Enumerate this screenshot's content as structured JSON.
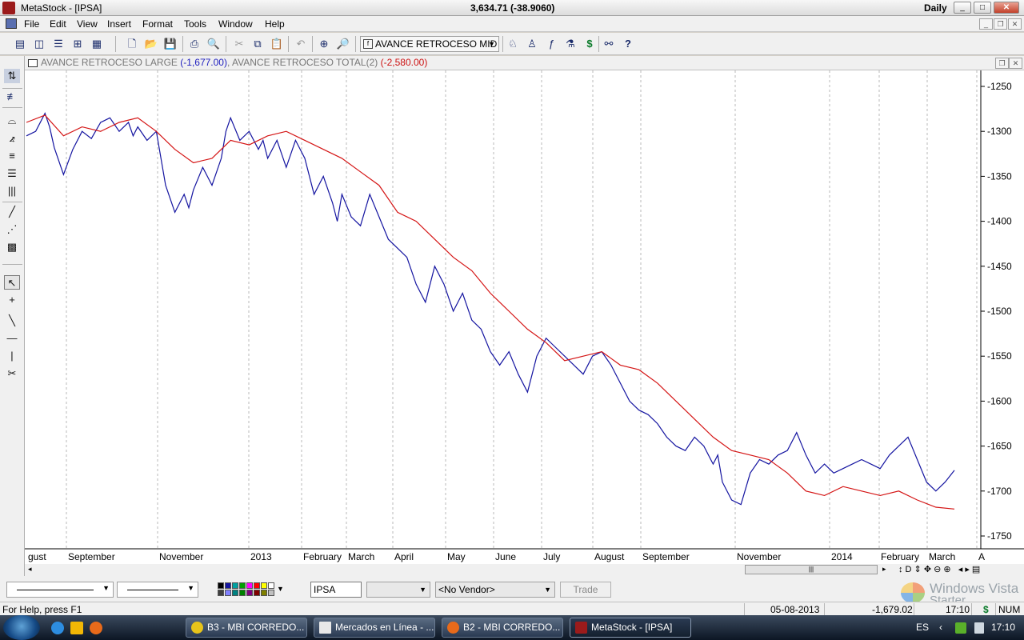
{
  "window": {
    "title": "MetaStock - [IPSA]",
    "quote": "3,634.71 (-38.9060)",
    "period": "Daily",
    "controls": [
      "_",
      "□",
      "✕"
    ]
  },
  "menu": [
    "File",
    "Edit",
    "View",
    "Insert",
    "Format",
    "Tools",
    "Window",
    "Help"
  ],
  "toolbar": {
    "indicator_selected": "AVANCE RETROCESO MID",
    "icons": [
      "tile-vertical-icon",
      "tile-columns-icon",
      "tile-rows-icon",
      "grid-icon",
      "new-icon",
      "open-icon",
      "save-icon",
      "print-icon",
      "print-preview-icon",
      "cut-icon",
      "copy-icon",
      "paste-icon",
      "undo-icon",
      "crosshair-icon",
      "zoom-icon",
      "expert-icon",
      "explorer-icon",
      "formula-icon",
      "system-tester-icon",
      "dollar-icon",
      "binoculars-icon",
      "help-icon"
    ]
  },
  "chart_window": {
    "series_label_1": "AVANCE RETROCESO LARGE",
    "series_value_1": "(-1,677.00)",
    "separator": ", ",
    "series_label_2": "AVANCE RETROCESO TOTAL(2)",
    "series_value_2": "(-2,580.00)"
  },
  "chart_data": {
    "type": "line",
    "colors": {
      "series_1": "#1414a0",
      "series_2": "#d41414",
      "grid": "#b8b8b8"
    },
    "ylim": [
      -1750,
      -1250
    ],
    "y_ticks": [
      -1250,
      -1300,
      -1350,
      -1400,
      -1450,
      -1500,
      -1550,
      -1600,
      -1650,
      -1700,
      -1750
    ],
    "x_ticks": [
      "gust",
      "September",
      "November",
      "2013",
      "February",
      "March",
      "April",
      "May",
      "June",
      "July",
      "August",
      "September",
      "November",
      "2014",
      "February",
      "March",
      "A"
    ],
    "series": [
      {
        "name": "AVANCE RETROCESO LARGE",
        "x": [
          0.0,
          0.01,
          0.02,
          0.025,
          0.03,
          0.04,
          0.05,
          0.06,
          0.07,
          0.08,
          0.09,
          0.1,
          0.11,
          0.115,
          0.12,
          0.13,
          0.14,
          0.15,
          0.16,
          0.17,
          0.175,
          0.18,
          0.19,
          0.2,
          0.21,
          0.215,
          0.22,
          0.23,
          0.24,
          0.25,
          0.255,
          0.26,
          0.27,
          0.28,
          0.29,
          0.3,
          0.31,
          0.32,
          0.33,
          0.335,
          0.34,
          0.35,
          0.36,
          0.37,
          0.38,
          0.39,
          0.4,
          0.41,
          0.42,
          0.43,
          0.44,
          0.45,
          0.46,
          0.47,
          0.48,
          0.49,
          0.5,
          0.51,
          0.52,
          0.53,
          0.54,
          0.55,
          0.56,
          0.57,
          0.58,
          0.59,
          0.6,
          0.61,
          0.62,
          0.63,
          0.64,
          0.65,
          0.66,
          0.67,
          0.68,
          0.69,
          0.7,
          0.71,
          0.72,
          0.73,
          0.74,
          0.745,
          0.75,
          0.76,
          0.77,
          0.78,
          0.79,
          0.8,
          0.81,
          0.82,
          0.83,
          0.84,
          0.85,
          0.86,
          0.87,
          0.88,
          0.89,
          0.9,
          0.91,
          0.92,
          0.93,
          0.94,
          0.95,
          0.96,
          0.97,
          0.98,
          0.99,
          1.0
        ],
        "y": [
          -1305,
          -1300,
          -1280,
          -1295,
          -1318,
          -1348,
          -1320,
          -1300,
          -1308,
          -1290,
          -1285,
          -1300,
          -1290,
          -1305,
          -1295,
          -1310,
          -1300,
          -1360,
          -1390,
          -1370,
          -1385,
          -1365,
          -1340,
          -1360,
          -1330,
          -1300,
          -1285,
          -1310,
          -1300,
          -1320,
          -1310,
          -1330,
          -1310,
          -1340,
          -1310,
          -1330,
          -1370,
          -1350,
          -1380,
          -1400,
          -1370,
          -1395,
          -1405,
          -1370,
          -1395,
          -1420,
          -1430,
          -1440,
          -1470,
          -1490,
          -1450,
          -1470,
          -1500,
          -1480,
          -1510,
          -1520,
          -1545,
          -1560,
          -1545,
          -1570,
          -1590,
          -1550,
          -1530,
          -1540,
          -1550,
          -1560,
          -1570,
          -1550,
          -1545,
          -1560,
          -1580,
          -1600,
          -1610,
          -1615,
          -1625,
          -1640,
          -1650,
          -1655,
          -1640,
          -1650,
          -1670,
          -1660,
          -1690,
          -1710,
          -1715,
          -1680,
          -1665,
          -1670,
          -1660,
          -1655,
          -1635,
          -1660,
          -1680,
          -1670,
          -1680,
          -1675,
          -1670,
          -1665,
          -1670,
          -1675,
          -1660,
          -1650,
          -1640,
          -1665,
          -1690,
          -1700,
          -1690,
          -1677
        ]
      },
      {
        "name": "AVANCE RETROCESO TOTAL(2)",
        "x": [
          0.0,
          0.02,
          0.04,
          0.06,
          0.08,
          0.1,
          0.12,
          0.14,
          0.16,
          0.18,
          0.2,
          0.22,
          0.24,
          0.26,
          0.28,
          0.3,
          0.32,
          0.34,
          0.36,
          0.38,
          0.4,
          0.42,
          0.44,
          0.46,
          0.48,
          0.5,
          0.52,
          0.54,
          0.56,
          0.58,
          0.6,
          0.62,
          0.64,
          0.66,
          0.68,
          0.7,
          0.72,
          0.74,
          0.76,
          0.78,
          0.8,
          0.82,
          0.84,
          0.86,
          0.88,
          0.9,
          0.92,
          0.94,
          0.96,
          0.98,
          1.0
        ],
        "y": [
          -1290,
          -1282,
          -1305,
          -1295,
          -1300,
          -1290,
          -1285,
          -1300,
          -1320,
          -1335,
          -1330,
          -1310,
          -1315,
          -1305,
          -1300,
          -1310,
          -1320,
          -1330,
          -1345,
          -1360,
          -1390,
          -1400,
          -1420,
          -1440,
          -1455,
          -1480,
          -1500,
          -1520,
          -1535,
          -1555,
          -1550,
          -1545,
          -1560,
          -1565,
          -1580,
          -1600,
          -1620,
          -1640,
          -1655,
          -1660,
          -1665,
          -1680,
          -1700,
          -1705,
          -1695,
          -1700,
          -1705,
          -1700,
          -1710,
          -1718,
          -1720
        ]
      }
    ]
  },
  "bottom_bar": {
    "symbol": "IPSA",
    "vendor": "<No Vendor>",
    "trade": "Trade",
    "watermark_line1": "Windows Vista",
    "watermark_line2": "Starter"
  },
  "status_bar": {
    "help": "For Help, press F1",
    "date": "05-08-2013",
    "value": "-1,679.02",
    "time": "17:10",
    "currency": "$",
    "num": "NUM"
  },
  "taskbar": {
    "tasks": [
      "B3 - MBI CORREDO...",
      "Mercados en Línea - ...",
      "B2 - MBI CORREDO...",
      "MetaStock - [IPSA]"
    ],
    "lang": "ES",
    "clock": "17:10"
  }
}
